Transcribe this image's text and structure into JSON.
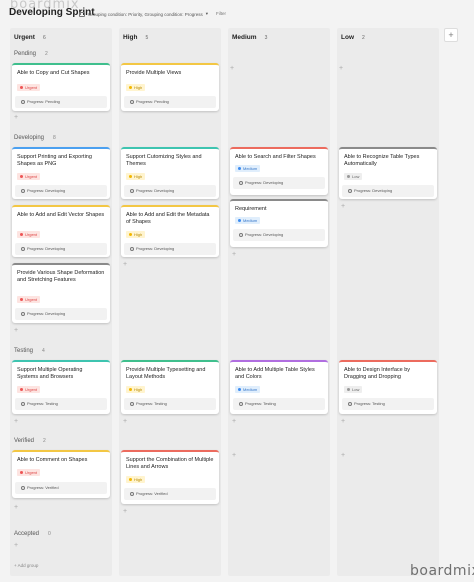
{
  "watermark": "boardmix",
  "title": "Developing Sprint",
  "grouping_text": "Grouping condition: Priority, Grouping condition: Progress",
  "filter_label": "Filter",
  "add_column": "+",
  "columns": [
    {
      "label": "Urgent",
      "count": "6"
    },
    {
      "label": "High",
      "count": "5"
    },
    {
      "label": "Medium",
      "count": "3"
    },
    {
      "label": "Low",
      "count": "2"
    }
  ],
  "groups": [
    {
      "label": "Pending",
      "count": "2"
    },
    {
      "label": "Developing",
      "count": "8"
    },
    {
      "label": "Testing",
      "count": "4"
    },
    {
      "label": "Verified",
      "count": "2"
    },
    {
      "label": "Accepted",
      "count": "0"
    }
  ],
  "cards": [
    {
      "title": "Able to Copy and Cut Shapes",
      "tag": "Urgent",
      "progress": "Progress: Pending"
    },
    {
      "title": "Provide Multiple Views",
      "tag": "High",
      "progress": "Progress: Pending"
    },
    {
      "title": "Support Printing and Exporting Shapes as PNG",
      "tag": "Urgent",
      "progress": "Progress: Developing"
    },
    {
      "title": "Able to Add and Edit Vector Shapes",
      "tag": "Urgent",
      "progress": "Progress: Developing"
    },
    {
      "title": "Provide Various Shape Deformation and Stretching Features",
      "tag": "Urgent",
      "progress": "Progress: Developing"
    },
    {
      "title": "Support Cutomizing Styles and Themes",
      "tag": "High",
      "progress": "Progress: Developing"
    },
    {
      "title": "Able to Add and Edit the Metadata of Shapes",
      "tag": "High",
      "progress": "Progress: Developing"
    },
    {
      "title": "Able to Search and Filter Shapes",
      "tag": "Medium",
      "progress": "Progress: Developing"
    },
    {
      "title": "Requirement",
      "tag": "Medium",
      "progress": "Progress: Developing"
    },
    {
      "title": "Able to Recognize Table Types Automatically",
      "tag": "Low",
      "progress": "Progress: Developing"
    },
    {
      "title": "Support Multiple Operating Systems and Browsers",
      "tag": "Urgent",
      "progress": "Progress: Testing"
    },
    {
      "title": "Provide Multiple Typesetting and Layout Methods",
      "tag": "High",
      "progress": "Progress: Testing"
    },
    {
      "title": "Able to Add Multiple Table Styles and Colors",
      "tag": "Medium",
      "progress": "Progress: Testing"
    },
    {
      "title": "Able to Design Interface by Dragging and Dropping",
      "tag": "Low",
      "progress": "Progress: Testing"
    },
    {
      "title": "Able to Comment on Shapes",
      "tag": "Urgent",
      "progress": "Progress: Verified"
    },
    {
      "title": "Support the Combination of Multiple Lines and Arrows",
      "tag": "High",
      "progress": "Progress: Verified"
    }
  ],
  "plus": "+",
  "add_group": "+ Add group",
  "colors": {
    "urgent": "#e55",
    "high": "#f3b700",
    "medium": "#3d8cf0",
    "low": "#999"
  }
}
